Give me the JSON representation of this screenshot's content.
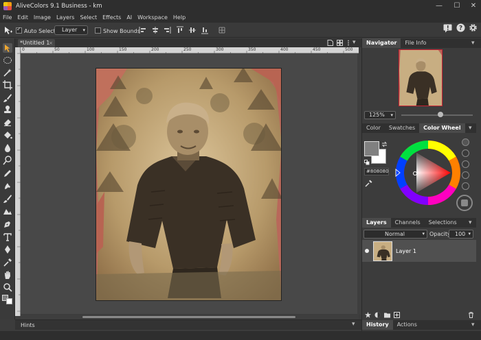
{
  "window": {
    "title": "AliveColors 9.1 Business - km"
  },
  "menu": [
    "File",
    "Edit",
    "Image",
    "Layers",
    "Select",
    "Effects",
    "AI",
    "Workspace",
    "Help"
  ],
  "options": {
    "auto_select_label": "Auto Select",
    "auto_select_checked": true,
    "layer_mode": "Layer",
    "show_bounds_label": "Show Bounds",
    "show_bounds_checked": false
  },
  "document": {
    "tab_label": "*Untitled 1",
    "ruler_ticks": [
      "0",
      "50",
      "100",
      "150",
      "200",
      "250",
      "300",
      "350",
      "400",
      "450",
      "500"
    ]
  },
  "hints": {
    "label": "Hints"
  },
  "navigator": {
    "tabs": [
      "Navigator",
      "File Info"
    ],
    "active_tab": "Navigator",
    "zoom": "125%"
  },
  "color_panel": {
    "tabs": [
      "Color",
      "Swatches",
      "Color Wheel"
    ],
    "active_tab": "Color Wheel",
    "foreground": "#808080",
    "background": "#ffffff",
    "hex_value": "#808080"
  },
  "layers_panel": {
    "tabs": [
      "Layers",
      "Channels",
      "Selections"
    ],
    "active_tab": "Layers",
    "blend_mode": "Normal",
    "opacity_label": "Opacity:",
    "opacity_value": "100",
    "layers": [
      {
        "name": "Layer 1",
        "visible": true
      }
    ]
  },
  "history_panel": {
    "tabs": [
      "History",
      "Actions"
    ],
    "active_tab": "History"
  },
  "colors": {
    "accent": "#e8a33a",
    "panel_bg": "#3c3c3c",
    "title_bg": "#2e2e2e"
  }
}
